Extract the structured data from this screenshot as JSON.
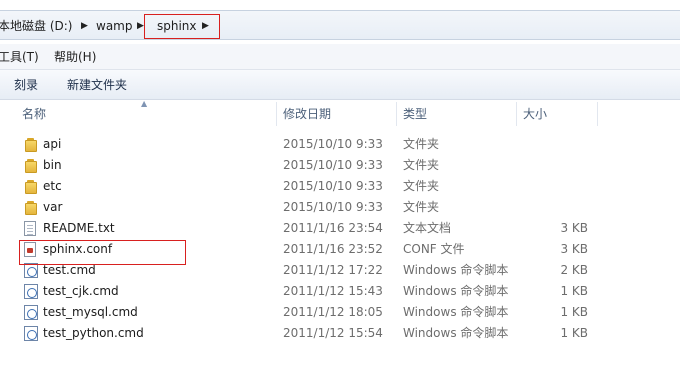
{
  "address": {
    "crumbs": [
      "本地磁盘 (D:)",
      "wamp",
      "sphinx"
    ],
    "arrow": "▶"
  },
  "menu": {
    "tools": "工具(T)",
    "help": "帮助(H)"
  },
  "commands": {
    "burn": "刻录",
    "new_folder": "新建文件夹"
  },
  "columns": {
    "name": "名称",
    "modified": "修改日期",
    "type": "类型",
    "size": "大小",
    "sort_indicator": "▲"
  },
  "files": [
    {
      "icon": "folder-icon",
      "name": "api",
      "modified": "2015/10/10 9:33",
      "type": "文件夹",
      "size": ""
    },
    {
      "icon": "folder-icon",
      "name": "bin",
      "modified": "2015/10/10 9:33",
      "type": "文件夹",
      "size": ""
    },
    {
      "icon": "folder-icon",
      "name": "etc",
      "modified": "2015/10/10 9:33",
      "type": "文件夹",
      "size": ""
    },
    {
      "icon": "folder-icon",
      "name": "var",
      "modified": "2015/10/10 9:33",
      "type": "文件夹",
      "size": ""
    },
    {
      "icon": "text-document-icon",
      "name": "README.txt",
      "modified": "2011/1/16 23:54",
      "type": "文本文档",
      "size": "3 KB"
    },
    {
      "icon": "config-file-icon",
      "name": "sphinx.conf",
      "modified": "2011/1/16 23:52",
      "type": "CONF 文件",
      "size": "3 KB"
    },
    {
      "icon": "command-script-icon",
      "name": "test.cmd",
      "modified": "2011/1/12 17:22",
      "type": "Windows 命令脚本",
      "size": "2 KB"
    },
    {
      "icon": "command-script-icon",
      "name": "test_cjk.cmd",
      "modified": "2011/1/12 15:43",
      "type": "Windows 命令脚本",
      "size": "1 KB"
    },
    {
      "icon": "command-script-icon",
      "name": "test_mysql.cmd",
      "modified": "2011/1/12 18:05",
      "type": "Windows 命令脚本",
      "size": "1 KB"
    },
    {
      "icon": "command-script-icon",
      "name": "test_python.cmd",
      "modified": "2011/1/12 15:54",
      "type": "Windows 命令脚本",
      "size": "1 KB"
    }
  ],
  "colors": {
    "highlight_box": "#d8201f",
    "folder": "#e4b53d",
    "header_text": "#4c607a"
  }
}
